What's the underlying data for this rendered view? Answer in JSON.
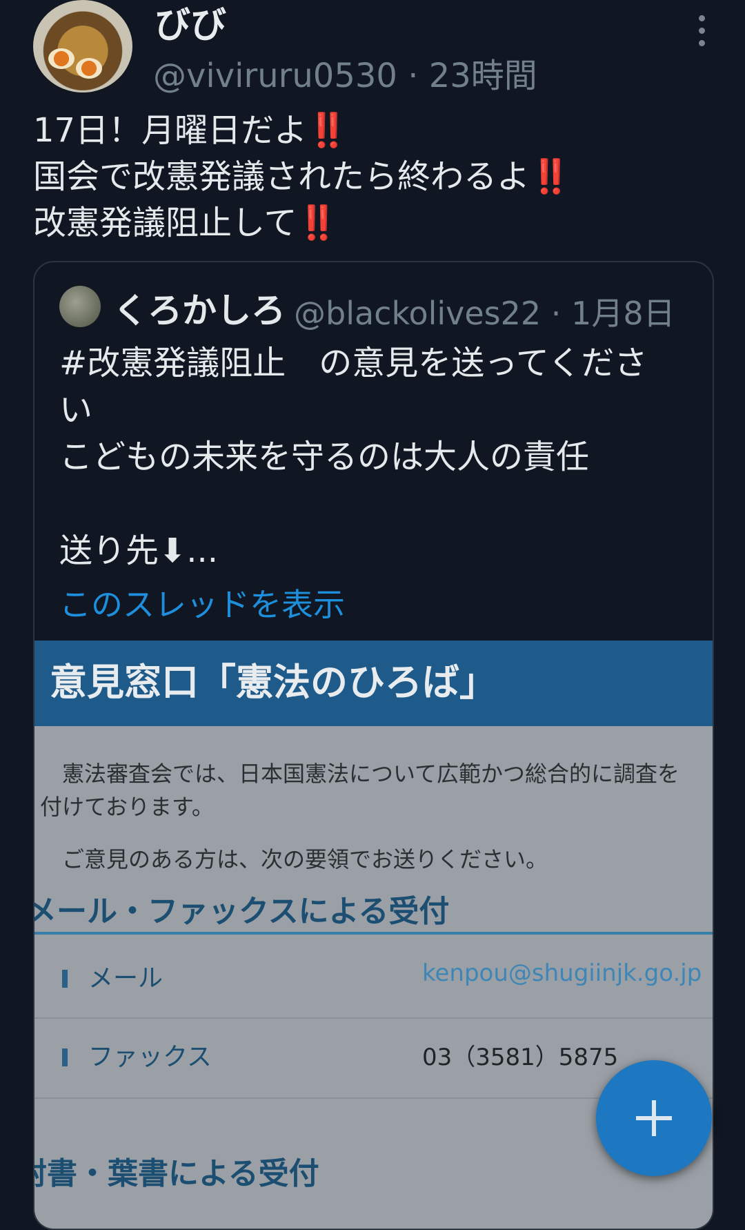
{
  "tweet": {
    "author_name": "びび",
    "meta": "@viviruru0530 · 23時間",
    "lines": [
      {
        "text": "17日！月曜日だよ",
        "mark": "‼️"
      },
      {
        "text": "国会で改憲発議されたら終わるよ",
        "mark": "‼️"
      },
      {
        "text": "改憲発議阻止して",
        "mark": "‼️"
      }
    ]
  },
  "quote": {
    "author_name": "くろかしろ",
    "meta": "@blackolives22 · 1月8日",
    "lines": [
      "#改憲発議阻止　の意見を送ってくださ",
      "い",
      "こどもの未来を守るのは大人の責任",
      "",
      "送り先⬇..."
    ],
    "thread_link": "このスレッドを表示",
    "media": {
      "title": "意見窓口「憲法のひろば」",
      "para1_line1": "憲法審査会では、日本国憲法について広範かつ総合的に調査を",
      "para1_line2": "付けております。",
      "para2": "ご意見のある方は、次の要領でお送りください。",
      "section1": "メール・ファックスによる受付",
      "rows": [
        {
          "label": "メール",
          "value": "kenpou@shugiinjk.go.jp",
          "value_color": "#3d86b6"
        },
        {
          "label": "ファックス",
          "value": "03（3581）5875",
          "value_color": "#1f2428"
        }
      ],
      "section2": "封書・葉書による受付"
    }
  },
  "fab": {
    "icon": "plus-icon"
  }
}
